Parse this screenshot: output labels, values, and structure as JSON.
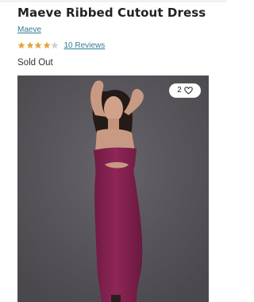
{
  "product": {
    "title": "Maeve Ribbed Cutout Dress",
    "brand": "Maeve",
    "rating": 4,
    "rating_max": 5,
    "reviews_label": "10 Reviews",
    "status": "Sold Out"
  },
  "gallery": {
    "like_count": "2",
    "like_icon": "heart-outline-icon"
  },
  "colors": {
    "link": "#2f7d96",
    "star_filled": "#e8a33c",
    "star_empty": "#cfcfcf",
    "dress": "#8a2353",
    "photo_background": "#545257"
  }
}
